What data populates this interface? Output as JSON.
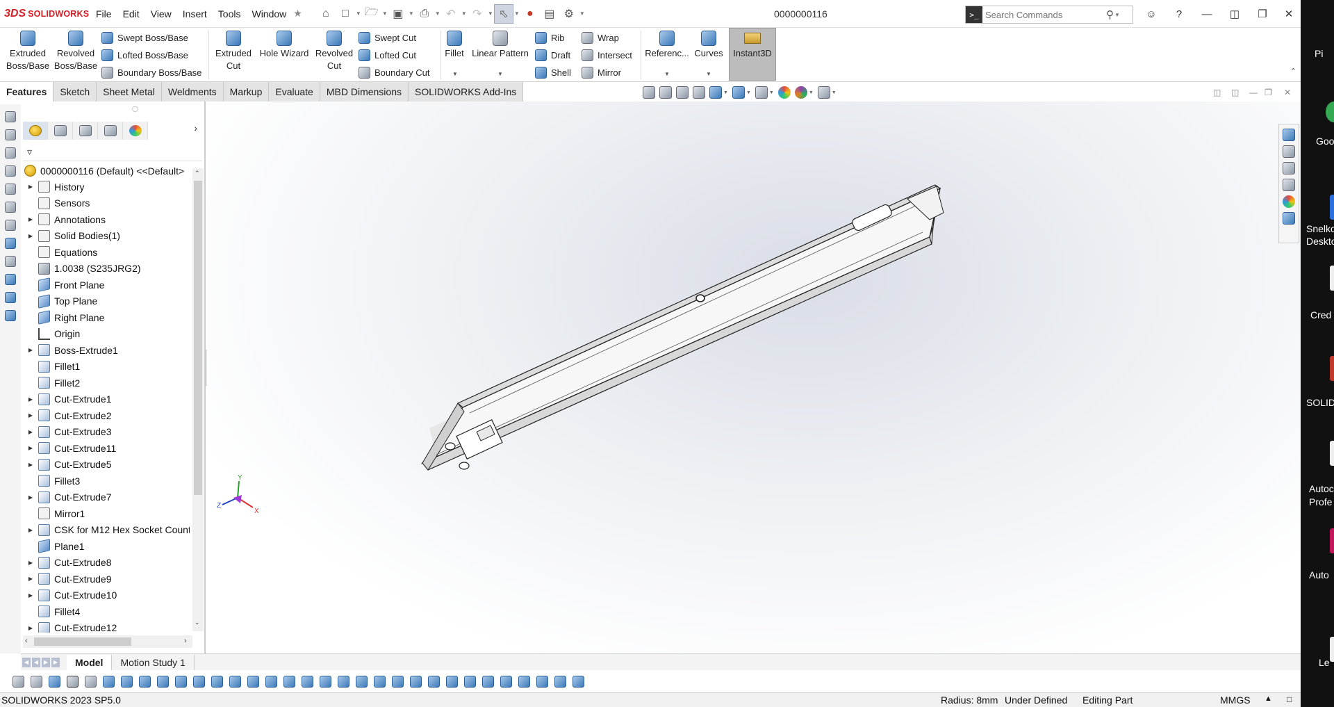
{
  "app": {
    "logo_mark": "3DS",
    "logo_name": "SOLIDWORKS",
    "document_title": "0000000116"
  },
  "menu": [
    "File",
    "Edit",
    "View",
    "Insert",
    "Tools",
    "Window"
  ],
  "search": {
    "placeholder": "Search Commands"
  },
  "ribbon": {
    "extruded_boss": [
      "Extruded",
      "Boss/Base"
    ],
    "revolved_boss": [
      "Revolved",
      "Boss/Base"
    ],
    "swept_boss": "Swept Boss/Base",
    "lofted_boss": "Lofted Boss/Base",
    "boundary_boss": "Boundary Boss/Base",
    "extruded_cut": [
      "Extruded",
      "Cut"
    ],
    "hole_wizard": "Hole Wizard",
    "revolved_cut": [
      "Revolved",
      "Cut"
    ],
    "swept_cut": "Swept Cut",
    "lofted_cut": "Lofted Cut",
    "boundary_cut": "Boundary Cut",
    "fillet": "Fillet",
    "linear_pattern": "Linear Pattern",
    "rib": "Rib",
    "draft": "Draft",
    "shell": "Shell",
    "wrap": "Wrap",
    "intersect": "Intersect",
    "mirror": "Mirror",
    "reference": "Referenc...",
    "curves": "Curves",
    "instant3d": "Instant3D"
  },
  "tabs": [
    "Features",
    "Sketch",
    "Sheet Metal",
    "Weldments",
    "Markup",
    "Evaluate",
    "MBD Dimensions",
    "SOLIDWORKS Add-Ins"
  ],
  "tree": {
    "root": "0000000116 (Default) <<Default>",
    "items": [
      {
        "label": "History",
        "icon": "history-icon",
        "expandable": true
      },
      {
        "label": "Sensors",
        "icon": "sensors-icon",
        "expandable": false
      },
      {
        "label": "Annotations",
        "icon": "annotations-icon",
        "expandable": true
      },
      {
        "label": "Solid Bodies(1)",
        "icon": "solid-bodies-icon",
        "expandable": true
      },
      {
        "label": "Equations",
        "icon": "equations-icon",
        "expandable": false
      },
      {
        "label": "1.0038 (S235JRG2)",
        "icon": "material-icon",
        "expandable": false
      },
      {
        "label": "Front Plane",
        "icon": "plane-icon",
        "expandable": false
      },
      {
        "label": "Top Plane",
        "icon": "plane-icon",
        "expandable": false
      },
      {
        "label": "Right Plane",
        "icon": "plane-icon",
        "expandable": false
      },
      {
        "label": "Origin",
        "icon": "origin-icon",
        "expandable": false
      },
      {
        "label": "Boss-Extrude1",
        "icon": "extrude-icon",
        "expandable": true
      },
      {
        "label": "Fillet1",
        "icon": "fillet-icon",
        "expandable": false
      },
      {
        "label": "Fillet2",
        "icon": "fillet-icon",
        "expandable": false
      },
      {
        "label": "Cut-Extrude1",
        "icon": "cut-extrude-icon",
        "expandable": true
      },
      {
        "label": "Cut-Extrude2",
        "icon": "cut-extrude-icon",
        "expandable": true
      },
      {
        "label": "Cut-Extrude3",
        "icon": "cut-extrude-icon",
        "expandable": true
      },
      {
        "label": "Cut-Extrude11",
        "icon": "cut-extrude-icon",
        "expandable": true
      },
      {
        "label": "Cut-Extrude5",
        "icon": "cut-extrude-icon",
        "expandable": true
      },
      {
        "label": "Fillet3",
        "icon": "fillet-icon",
        "expandable": false
      },
      {
        "label": "Cut-Extrude7",
        "icon": "cut-extrude-icon",
        "expandable": true
      },
      {
        "label": "Mirror1",
        "icon": "mirror-icon",
        "expandable": false
      },
      {
        "label": "CSK for M12 Hex Socket Count",
        "icon": "hole-icon",
        "expandable": true
      },
      {
        "label": "Plane1",
        "icon": "plane-icon",
        "expandable": false
      },
      {
        "label": "Cut-Extrude8",
        "icon": "cut-extrude-icon",
        "expandable": true
      },
      {
        "label": "Cut-Extrude9",
        "icon": "cut-extrude-icon",
        "expandable": true
      },
      {
        "label": "Cut-Extrude10",
        "icon": "cut-extrude-icon",
        "expandable": true
      },
      {
        "label": "Fillet4",
        "icon": "fillet-icon",
        "expandable": false
      },
      {
        "label": "Cut-Extrude12",
        "icon": "cut-extrude-icon",
        "expandable": true
      }
    ]
  },
  "bottom_tabs": [
    "Model",
    "Motion Study 1"
  ],
  "triad": {
    "x": "X",
    "y": "Y",
    "z": "Z"
  },
  "status": {
    "version": "SOLIDWORKS 2023 SP5.0",
    "radius": "Radius: 8mm",
    "definition": "Under Defined",
    "mode": "Editing Part",
    "units": "MMGS"
  },
  "desktop_labels": [
    "Pi",
    "Goo",
    "Snelko",
    "Deskto",
    "Cred",
    "SOLID",
    "Autoc",
    "Profe",
    "Auto",
    "Le"
  ],
  "colors": {
    "accent": "#d31f26",
    "instant3d_active": "#bcbcbc",
    "graphics_bg": "#eef0f4"
  }
}
